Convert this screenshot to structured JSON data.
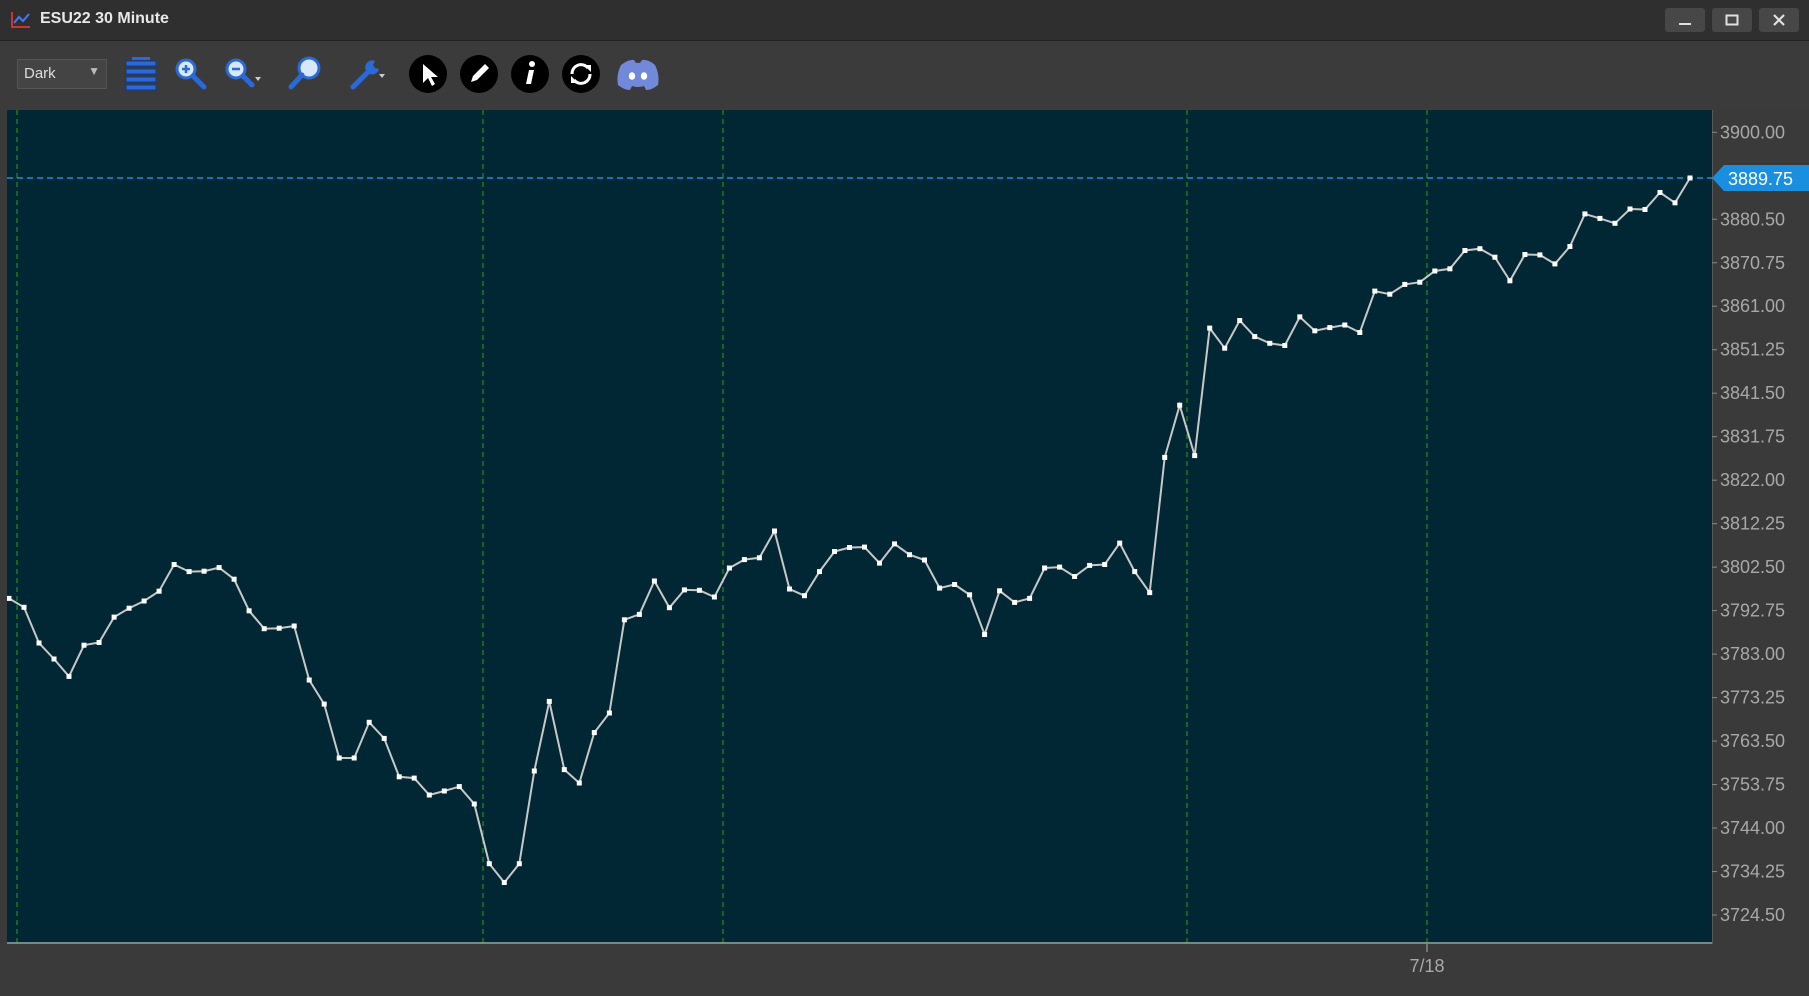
{
  "window": {
    "title": "ESU22 30 Minute",
    "buttons": [
      "minimize",
      "maximize",
      "close"
    ]
  },
  "toolbar": {
    "theme_select": {
      "value": "Dark"
    },
    "tools": [
      "auto-scale-icon",
      "zoom-in-icon",
      "zoom-out-icon",
      "magnifier-icon",
      "wrench-icon",
      "pointer-icon",
      "pencil-icon",
      "info-icon",
      "refresh-icon",
      "discord-icon"
    ]
  },
  "colors": {
    "background": "#012734",
    "line": "#c8c8c8",
    "gridline": "#1d7a1d",
    "last_price": "#1a8fe0"
  },
  "chart_data": {
    "type": "line",
    "title": "",
    "y_ticks": [
      "3900.00",
      "3880.50",
      "3870.75",
      "3861.00",
      "3851.25",
      "3841.50",
      "3831.75",
      "3822.00",
      "3812.25",
      "3802.50",
      "3792.75",
      "3783.00",
      "3773.25",
      "3763.50",
      "3753.75",
      "3744.00",
      "3734.25",
      "3724.50"
    ],
    "x_label": "7/18",
    "last_price": "3889.75",
    "ylim": [
      3718,
      3905
    ],
    "y_values": [
      3795.5,
      3793.5,
      3785.5,
      3781.9,
      3778,
      3785,
      3785.6,
      3791.3,
      3793.3,
      3794.9,
      3797.1,
      3803.1,
      3801.5,
      3801.6,
      3802.4,
      3799.8,
      3792.7,
      3788.7,
      3788.8,
      3789.3,
      3777.2,
      3771.8,
      3759.7,
      3759.7,
      3767.7,
      3764.1,
      3755.5,
      3755.2,
      3751.4,
      3752.3,
      3753.3,
      3749.4,
      3736,
      3731.8,
      3736,
      3756.8,
      3772.4,
      3757.1,
      3754.1,
      3765.4,
      3769.8,
      3790.7,
      3791.9,
      3799.4,
      3793.4,
      3797.4,
      3797.3,
      3795.8,
      3802.3,
      3804.2,
      3804.6,
      3810.6,
      3797.6,
      3796.1,
      3801.5,
      3806,
      3806.9,
      3807,
      3803.4,
      3807.7,
      3805.3,
      3804.1,
      3797.8,
      3798.6,
      3796.3,
      3787.4,
      3797.2,
      3794.6,
      3795.5,
      3802.3,
      3802.5,
      3800.4,
      3802.9,
      3803.1,
      3807.9,
      3801.5,
      3796.8,
      3827.1,
      3838.8,
      3827.5,
      3856.1,
      3851.6,
      3857.8,
      3854.2,
      3852.7,
      3852.2,
      3858.6,
      3855.5,
      3856.2,
      3856.8,
      3855.1,
      3864.4,
      3863.7,
      3865.9,
      3866.4,
      3868.9,
      3869.4,
      3873.5,
      3873.9,
      3872,
      3866.7,
      3872.6,
      3872.5,
      3870.5,
      3874.4,
      3881.7,
      3880.7,
      3879.6,
      3882.8,
      3882.7,
      3886.5,
      3884.2,
      3889.75
    ]
  }
}
